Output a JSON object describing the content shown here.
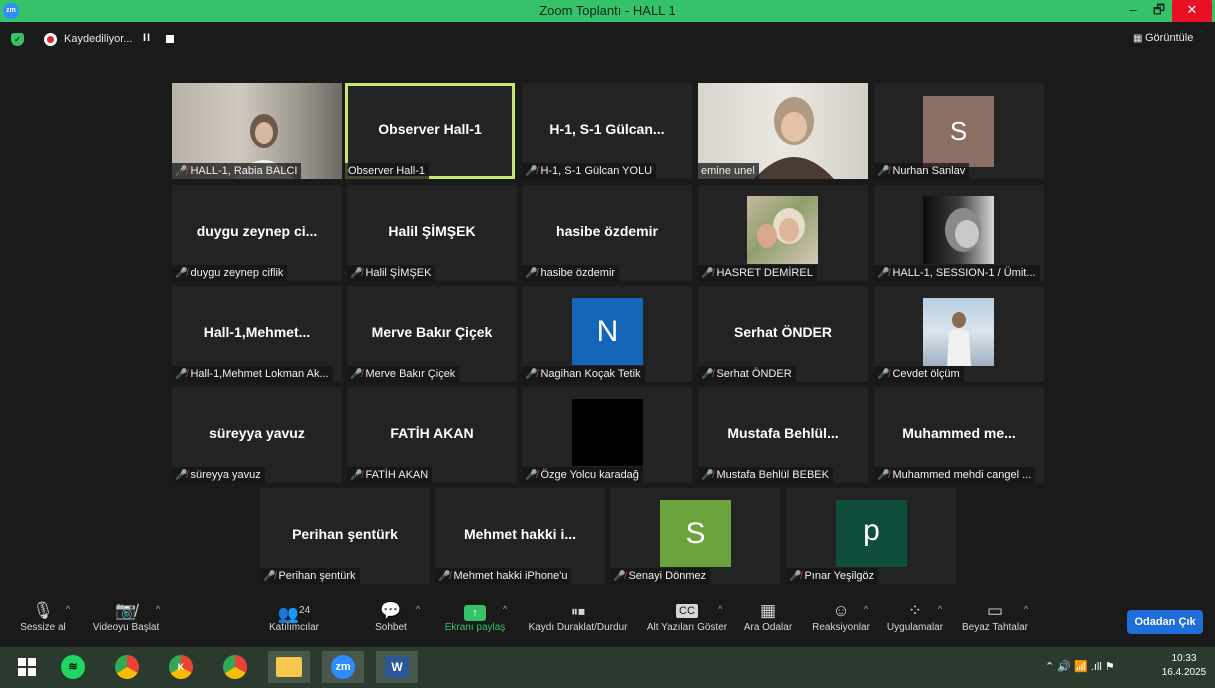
{
  "window": {
    "title": "Zoom Toplantı - HALL 1",
    "minimize": "–",
    "restore": "🗗",
    "close": "✕",
    "accent_color": "#35c26b",
    "zoom_logo": "zm"
  },
  "recording": {
    "status": "Kaydediliyor...",
    "pause": "II",
    "view_label": "Görüntüle",
    "view_icon": "▦"
  },
  "participants": [
    {
      "display": "",
      "label": "HALL-1, Rabia BALCI",
      "muted": true,
      "kind": "video"
    },
    {
      "display": "Observer Hall-1",
      "label": "Observer Hall-1",
      "muted": false,
      "kind": "name",
      "active": true
    },
    {
      "display": "H-1, S-1 Gülcan...",
      "label": "H-1, S-1 Gülcan YOLU",
      "muted": true,
      "kind": "name"
    },
    {
      "display": "",
      "label": "emine unel",
      "muted": false,
      "kind": "video"
    },
    {
      "display": "S",
      "label": "Nurhan Sanlav",
      "muted": true,
      "kind": "avatar",
      "color": "#8c6f64"
    },
    {
      "display": "duygu zeynep ci...",
      "label": "duygu zeynep ciflik",
      "muted": true,
      "kind": "name"
    },
    {
      "display": "Halil ŞİMŞEK",
      "label": "Halil ŞİMŞEK",
      "muted": true,
      "kind": "name"
    },
    {
      "display": "hasibe özdemir",
      "label": "hasibe özdemir",
      "muted": true,
      "kind": "name"
    },
    {
      "display": "",
      "label": "HASRET DEMİREL",
      "muted": true,
      "kind": "photo"
    },
    {
      "display": "",
      "label": "HALL-1, SESSION-1 / Ümit...",
      "muted": true,
      "kind": "photo"
    },
    {
      "display": "Hall-1,Mehmet...",
      "label": "Hall-1,Mehmet Lokman Ak...",
      "muted": true,
      "kind": "name"
    },
    {
      "display": "Merve Bakır Çiçek",
      "label": "Merve Bakır Çiçek",
      "muted": true,
      "kind": "name"
    },
    {
      "display": "N",
      "label": "Nagihan Koçak Tetik",
      "muted": true,
      "kind": "avatar",
      "color": "#1466b8"
    },
    {
      "display": "Serhat ÖNDER",
      "label": "Serhat ÖNDER",
      "muted": true,
      "kind": "name"
    },
    {
      "display": "",
      "label": "Cevdet ölçüm",
      "muted": true,
      "kind": "photo"
    },
    {
      "display": "süreyya yavuz",
      "label": "süreyya yavuz",
      "muted": true,
      "kind": "name"
    },
    {
      "display": "FATİH AKAN",
      "label": "FATİH AKAN",
      "muted": true,
      "kind": "name"
    },
    {
      "display": "",
      "label": "Özge Yolcu karadağ",
      "muted": true,
      "kind": "avatar",
      "color": "#000000"
    },
    {
      "display": "Mustafa Behlül...",
      "label": "Mustafa Behlül BEBEK",
      "muted": true,
      "kind": "name"
    },
    {
      "display": "Muhammed me...",
      "label": "Muhammed mehdi cangel ...",
      "muted": true,
      "kind": "name"
    },
    {
      "display": "Perihan şentürk",
      "label": "Perihan şentürk",
      "muted": true,
      "kind": "name"
    },
    {
      "display": "Mehmet hakki i...",
      "label": "Mehmet hakki iPhone'u",
      "muted": true,
      "kind": "name"
    },
    {
      "display": "S",
      "label": "Senayi Dönmez",
      "muted": true,
      "kind": "avatar",
      "color": "#6aa23c"
    },
    {
      "display": "p",
      "label": "Pınar Yeşilgöz",
      "muted": true,
      "kind": "avatar",
      "color": "#0f4d3c"
    }
  ],
  "toolbar": {
    "mute": "Sessize al",
    "video": "Videoyu Başlat",
    "participants": "Katılımcılar",
    "participants_count": "24",
    "chat": "Sohbet",
    "share": "Ekranı paylaş",
    "record": "Kaydı Duraklat/Durdur",
    "captions": "Alt Yazıları Göster",
    "captions_icon": "CC",
    "breakout": "Ara Odalar",
    "reactions": "Reaksiyonlar",
    "apps": "Uygulamalar",
    "whiteboard": "Beyaz Tahtalar",
    "leave": "Odadan Çık",
    "share_color": "#35c26b",
    "leave_color": "#1f6ddb"
  },
  "taskbar": {
    "apps": [
      "windows-start",
      "spotify",
      "chrome",
      "chrome-profile-k",
      "chrome-alt",
      "file-explorer",
      "zoom",
      "word"
    ],
    "zoom_label": "zm",
    "word_label": "W",
    "k_label": "K",
    "time": "10:33",
    "date": "16.4.2025",
    "tray": "⌃  🔊  📶  .ıll  ⚑"
  }
}
